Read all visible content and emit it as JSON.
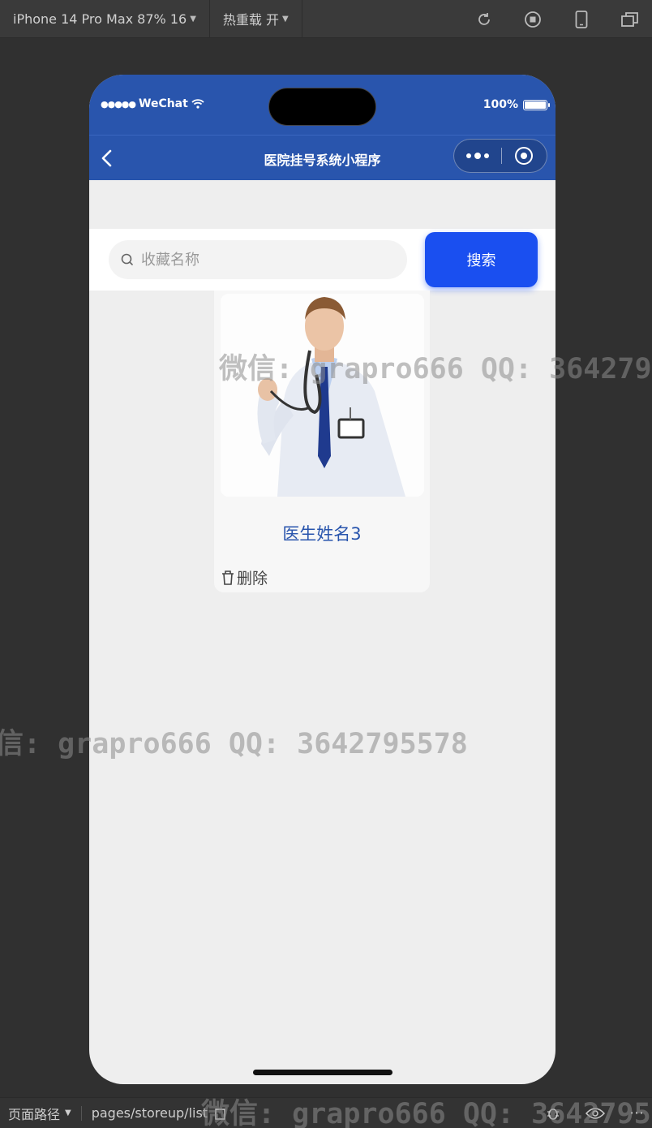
{
  "toolbar": {
    "device": "iPhone 14 Pro Max 87% 16",
    "hot_reload": "热重载 开",
    "icons": [
      "refresh-icon",
      "stop-icon",
      "phone-icon",
      "windows-icon"
    ]
  },
  "status_bar": {
    "carrier": "WeChat",
    "battery_text": "100%"
  },
  "nav": {
    "title": "医院挂号系统小程序"
  },
  "search": {
    "placeholder": "收藏名称",
    "button_label": "搜索"
  },
  "favorites": [
    {
      "name": "医生姓名3",
      "delete_label": "删除"
    }
  ],
  "watermark": {
    "text_top": "微信: grapro666 QQ: 364279",
    "text_mid": "信: grapro666 QQ: 3642795578",
    "text_bottom": "微信: grapro666 QQ: 3642795"
  },
  "bottom_bar": {
    "path_label": "页面路径",
    "path": "pages/storeup/list"
  },
  "colors": {
    "brand": "#2955ad",
    "search_button": "#1a4ff0",
    "page_bg": "#eeeeee"
  }
}
